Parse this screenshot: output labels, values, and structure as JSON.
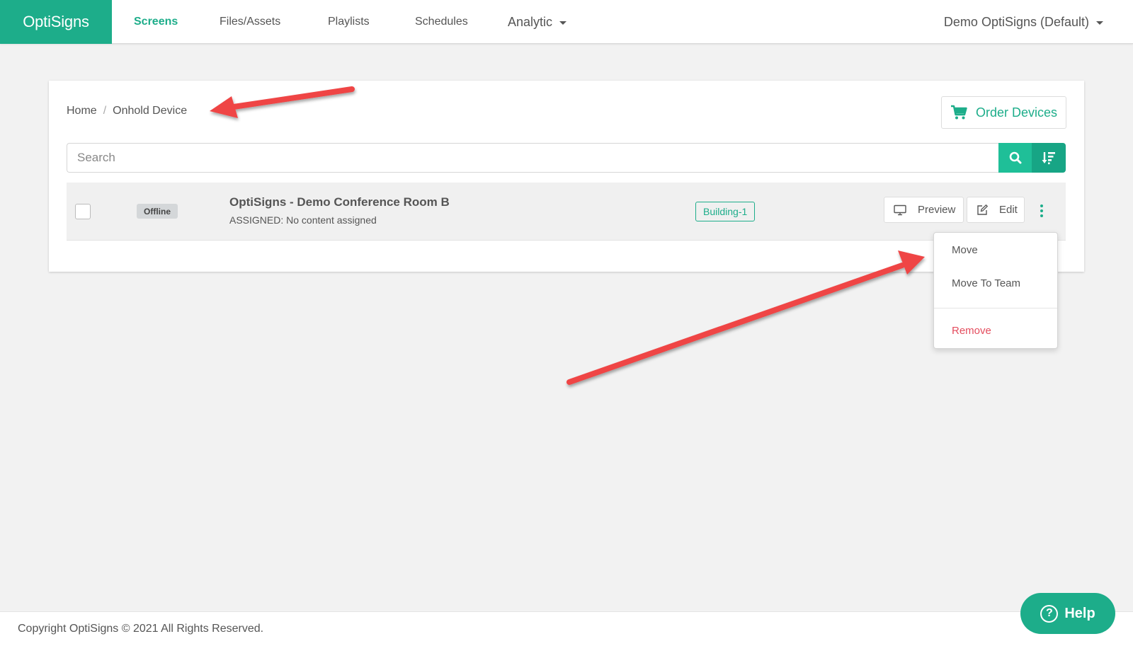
{
  "nav": {
    "brand": "OptiSigns",
    "items": [
      {
        "label": "Screens",
        "active": true
      },
      {
        "label": "Files/Assets"
      },
      {
        "label": "Playlists"
      },
      {
        "label": "Schedules"
      },
      {
        "label": "Analytic",
        "has_dropdown": true
      }
    ],
    "account": "Demo OptiSigns (Default)"
  },
  "breadcrumb": [
    "Home",
    "Onhold Device"
  ],
  "order_devices_label": "Order Devices",
  "search": {
    "placeholder": "Search",
    "value": ""
  },
  "device": {
    "status": "Offline",
    "name": "OptiSigns - Demo Conference Room B",
    "assigned": "ASSIGNED: No content assigned",
    "tag": "Building-1",
    "preview_label": "Preview",
    "edit_label": "Edit"
  },
  "menu": {
    "items": [
      "Move",
      "Move To Team"
    ],
    "danger_item": "Remove"
  },
  "footer": {
    "copyright": "Copyright OptiSigns © 2021 All Rights Reserved."
  },
  "help_label": "Help",
  "colors": {
    "accent": "#1dad8a",
    "danger": "#e44d5e",
    "annotation_arrow": "#ef4444"
  },
  "icons": [
    "cart-icon",
    "search-icon",
    "sort-icon",
    "monitor-icon",
    "edit-icon",
    "kebab-icon",
    "help-icon",
    "caret-down-icon"
  ]
}
